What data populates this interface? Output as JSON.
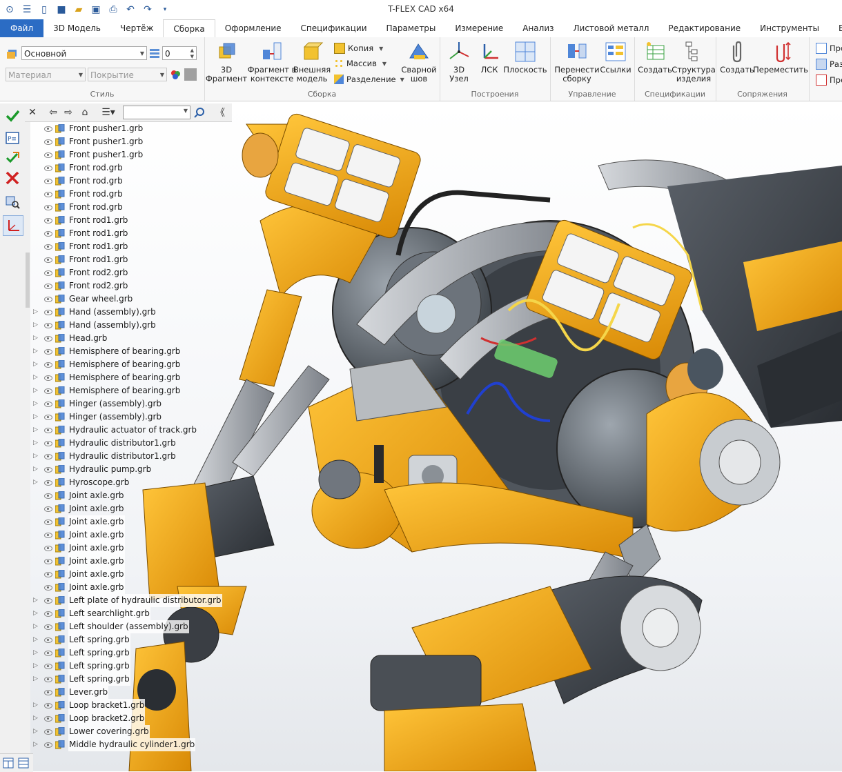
{
  "app": {
    "title": "T-FLEX CAD x64"
  },
  "quick_access": [
    "app-menu-icon",
    "hamburger-icon",
    "new-file-icon",
    "cube-icon",
    "open-folder-icon",
    "save-icon",
    "print-icon",
    "undo-icon",
    "redo-icon",
    "customize-icon"
  ],
  "tabs": [
    {
      "label": "Файл"
    },
    {
      "label": "3D Модель"
    },
    {
      "label": "Чертёж"
    },
    {
      "label": "Сборка"
    },
    {
      "label": "Оформление"
    },
    {
      "label": "Спецификации"
    },
    {
      "label": "Параметры"
    },
    {
      "label": "Измерение"
    },
    {
      "label": "Анализ"
    },
    {
      "label": "Листовой металл"
    },
    {
      "label": "Редактирование"
    },
    {
      "label": "Инструменты"
    },
    {
      "label": "Вид"
    }
  ],
  "ribbon": {
    "style": {
      "layer_value": "Основной",
      "priority_value": "0",
      "material_placeholder": "Материал",
      "coating_placeholder": "Покрытие",
      "label": "Стиль"
    },
    "assembly": {
      "fragment_3d": "3D\nФрагмент",
      "fragment_in_context": "Фрагмент в\nконтексте",
      "external_model": "Внешняя\nмодель",
      "copy": "Копия",
      "array": "Массив",
      "split": "Разделение",
      "weld": "Сварной\nшов",
      "label": "Сборка"
    },
    "constructions": {
      "node_3d": "3D\nУзел",
      "lcs": "ЛСК",
      "plane": "Плоскость",
      "label": "Построения"
    },
    "management": {
      "move_assembly": "Перенести\nсборку",
      "links": "Ссылки",
      "label": "Управление"
    },
    "specifications": {
      "create": "Создать",
      "product_structure": "Структура\nизделия",
      "label": "Спецификации"
    },
    "mates": {
      "create": "Создать",
      "move": "Переместить",
      "label": "Сопряжения"
    },
    "cut": {
      "item1": "Про",
      "item2": "Раз",
      "item3": "Пре"
    }
  },
  "tree_items": [
    {
      "label": "Front pusher1.grb",
      "expandable": false
    },
    {
      "label": "Front pusher1.grb",
      "expandable": false
    },
    {
      "label": "Front pusher1.grb",
      "expandable": false
    },
    {
      "label": "Front rod.grb",
      "expandable": false
    },
    {
      "label": "Front rod.grb",
      "expandable": false
    },
    {
      "label": "Front rod.grb",
      "expandable": false
    },
    {
      "label": "Front rod.grb",
      "expandable": false
    },
    {
      "label": "Front rod1.grb",
      "expandable": false
    },
    {
      "label": "Front rod1.grb",
      "expandable": false
    },
    {
      "label": "Front rod1.grb",
      "expandable": false
    },
    {
      "label": "Front rod1.grb",
      "expandable": false
    },
    {
      "label": "Front rod2.grb",
      "expandable": false
    },
    {
      "label": "Front rod2.grb",
      "expandable": false
    },
    {
      "label": "Gear wheel.grb",
      "expandable": false
    },
    {
      "label": "Hand (assembly).grb",
      "expandable": true
    },
    {
      "label": "Hand (assembly).grb",
      "expandable": true
    },
    {
      "label": "Head.grb",
      "expandable": true
    },
    {
      "label": "Hemisphere of bearing.grb",
      "expandable": true
    },
    {
      "label": "Hemisphere of bearing.grb",
      "expandable": true
    },
    {
      "label": "Hemisphere of bearing.grb",
      "expandable": true
    },
    {
      "label": "Hemisphere of bearing.grb",
      "expandable": true
    },
    {
      "label": "Hinger (assembly).grb",
      "expandable": true
    },
    {
      "label": "Hinger (assembly).grb",
      "expandable": true
    },
    {
      "label": "Hydraulic actuator of track.grb",
      "expandable": true
    },
    {
      "label": "Hydraulic distributor1.grb",
      "expandable": true
    },
    {
      "label": "Hydraulic distributor1.grb",
      "expandable": true
    },
    {
      "label": "Hydraulic pump.grb",
      "expandable": true
    },
    {
      "label": "Hyroscope.grb",
      "expandable": true
    },
    {
      "label": "Joint axle.grb",
      "expandable": false
    },
    {
      "label": "Joint axle.grb",
      "expandable": false
    },
    {
      "label": "Joint axle.grb",
      "expandable": false
    },
    {
      "label": "Joint axle.grb",
      "expandable": false
    },
    {
      "label": "Joint axle.grb",
      "expandable": false
    },
    {
      "label": "Joint axle.grb",
      "expandable": false
    },
    {
      "label": "Joint axle.grb",
      "expandable": false
    },
    {
      "label": "Joint axle.grb",
      "expandable": false
    },
    {
      "label": "Left plate of hydraulic distributor.grb",
      "expandable": true
    },
    {
      "label": "Left searchlight.grb",
      "expandable": true
    },
    {
      "label": "Left shoulder (assembly).grb",
      "expandable": true
    },
    {
      "label": "Left spring.grb",
      "expandable": true
    },
    {
      "label": "Left spring.grb",
      "expandable": true
    },
    {
      "label": "Left spring.grb",
      "expandable": true
    },
    {
      "label": "Left spring.grb",
      "expandable": true
    },
    {
      "label": "Lever.grb",
      "expandable": false
    },
    {
      "label": "Loop bracket1.grb",
      "expandable": true
    },
    {
      "label": "Loop bracket2.grb",
      "expandable": true
    },
    {
      "label": "Lower covering.grb",
      "expandable": true
    },
    {
      "label": "Middle hydraulic cylinder1.grb",
      "expandable": true
    }
  ],
  "colors": {
    "accent": "#2b6cc4",
    "robot_orange": "#f0a514",
    "robot_dark": "#3a3e44",
    "robot_gray": "#8a8f96"
  }
}
